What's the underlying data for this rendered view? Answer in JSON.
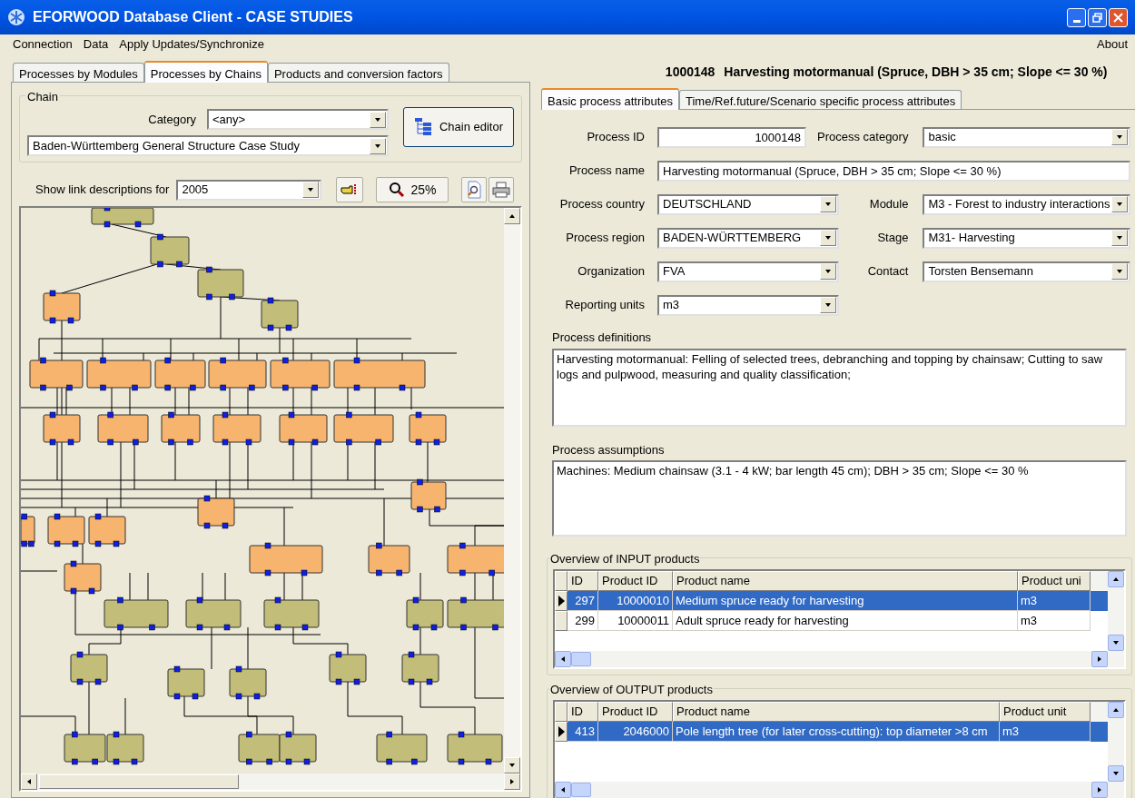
{
  "window": {
    "title": "EFORWOOD Database Client - CASE STUDIES"
  },
  "menu": {
    "items": [
      "Connection",
      "Data",
      "Apply Updates/Synchronize"
    ],
    "right_item": "About"
  },
  "left_tabs": [
    {
      "label": "Processes by Modules",
      "selected": false
    },
    {
      "label": "Processes by Chains",
      "selected": true
    },
    {
      "label": "Products and conversion factors",
      "selected": false
    }
  ],
  "chain": {
    "group_label": "Chain",
    "category_label": "Category",
    "category_value": "<any>",
    "chain_value": "Baden-Württemberg General Structure Case Study",
    "editor_button": "Chain editor"
  },
  "link_row": {
    "label": "Show link descriptions for",
    "value": "2005",
    "zoom_button": "25%"
  },
  "process_header": {
    "id": "1000148",
    "name": "Harvesting motormanual (Spruce, DBH > 35 cm; Slope <= 30 %)"
  },
  "right_tabs": [
    {
      "label": "Basic process attributes",
      "selected": true
    },
    {
      "label": "Time/Ref.future/Scenario specific process attributes",
      "selected": false
    }
  ],
  "form_rows": [
    {
      "left": {
        "label": "Process ID",
        "value": "1000148",
        "kind": "number"
      },
      "right": {
        "label": "Process category",
        "value": "basic",
        "kind": "dropdown"
      }
    },
    {
      "left": {
        "label": "Process name",
        "value": "Harvesting motormanual (Spruce, DBH > 35 cm; Slope <= 30 %)",
        "kind": "wide"
      }
    },
    {
      "left": {
        "label": "Process country",
        "value": "DEUTSCHLAND",
        "kind": "dropdown"
      },
      "right": {
        "label": "Module",
        "value": "M3 - Forest to industry interactions",
        "kind": "dropdown"
      }
    },
    {
      "left": {
        "label": "Process region",
        "value": "BADEN-WÜRTTEMBERG",
        "kind": "dropdown"
      },
      "right": {
        "label": "Stage",
        "value": "M31- Harvesting",
        "kind": "dropdown"
      }
    },
    {
      "left": {
        "label": "Organization",
        "value": "FVA",
        "kind": "dropdown"
      },
      "right": {
        "label": "Contact",
        "value": "Torsten Bensemann",
        "kind": "dropdown"
      }
    },
    {
      "left": {
        "label": "Reporting units",
        "value": "m3",
        "kind": "dropdown"
      }
    }
  ],
  "definitions": {
    "label": "Process definitions",
    "value": "Harvesting motormanual: Felling of selected trees, debranching and topping by chainsaw; Cutting to saw logs and pulpwood, measuring and quality classification;"
  },
  "assumptions": {
    "label": "Process assumptions",
    "value": "Machines: Medium chainsaw (3.1 - 4 kW; bar length 45 cm); DBH > 35 cm; Slope <= 30 %"
  },
  "input_products": {
    "title": "Overview of INPUT products",
    "columns": [
      "ID",
      "Product ID",
      "Product name",
      "Product uni"
    ],
    "rows": [
      {
        "cells": [
          "297",
          "10000010",
          "Medium spruce ready for harvesting",
          "m3"
        ],
        "selected": true
      },
      {
        "cells": [
          "299",
          "10000011",
          "Adult spruce ready for harvesting",
          "m3"
        ],
        "selected": false
      }
    ]
  },
  "output_products": {
    "title": "Overview of OUTPUT products",
    "columns": [
      "ID",
      "Product ID",
      "Product name",
      "Product unit"
    ],
    "rows": [
      {
        "cells": [
          "413",
          "2046000",
          "Pole length tree (for later cross-cutting):  top diameter >8 cm",
          "m3"
        ],
        "selected": true
      }
    ]
  }
}
